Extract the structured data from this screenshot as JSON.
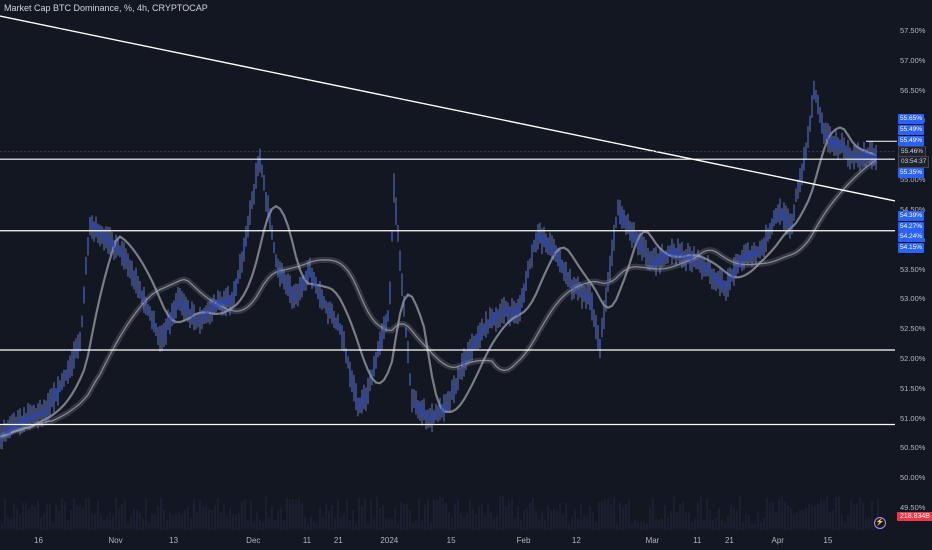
{
  "legend": {
    "text": "Market Cap BTC Dominance, %, 4h, CRYPTOCAP"
  },
  "colors": {
    "bg": "#131722",
    "price": "#3b5bd6",
    "price_light": "#7d8fdd",
    "level": "#ffffff",
    "ma_fast": "#a6a8b0",
    "ma_slow": "#5d606b",
    "tag_blue": "#2962ff",
    "volume_badge": "#f23645"
  },
  "icons": {
    "alert": "lightning-bolt-icon"
  },
  "axis_tags": {
    "t1": "55.65%",
    "t2": "55.49%",
    "t3": "55.49%",
    "current": "55.46%",
    "countdown": "03:54:37",
    "t4": "55.35%",
    "t5": "54.39%",
    "t6": "54.27%",
    "t7": "54.24%",
    "t8": "54.15%"
  },
  "volume_label": "218.834B",
  "chart_data": {
    "type": "line",
    "title": "Market Cap BTC Dominance, %, 4h, CRYPTOCAP",
    "xlabel": "",
    "ylabel": "",
    "ylim": [
      49.4,
      57.8
    ],
    "y_ticks": [
      "57.50%",
      "57.00%",
      "56.50%",
      "56.00%",
      "55.50%",
      "55.00%",
      "54.50%",
      "54.00%",
      "53.50%",
      "53.00%",
      "52.50%",
      "52.00%",
      "51.50%",
      "51.00%",
      "50.50%",
      "50.00%",
      "49.50%"
    ],
    "y_tick_values": [
      57.5,
      57.0,
      56.5,
      56.0,
      55.5,
      55.0,
      54.5,
      54.0,
      53.5,
      53.0,
      52.5,
      52.0,
      51.5,
      51.0,
      50.5,
      50.0,
      49.5
    ],
    "x_ticks": [
      "16",
      "Nov",
      "13",
      "Dec",
      "11",
      "21",
      "2024",
      "15",
      "Feb",
      "12",
      "Mar",
      "11",
      "21",
      "Apr",
      "15"
    ],
    "x_tick_values": [
      0.043,
      0.129,
      0.194,
      0.283,
      0.343,
      0.378,
      0.435,
      0.504,
      0.585,
      0.644,
      0.729,
      0.779,
      0.815,
      0.869,
      0.925
    ],
    "grid": false,
    "legend": "top-left",
    "series": [
      {
        "x": [
          0,
          0.03,
          0.05,
          0.07,
          0.09,
          0.1,
          0.12,
          0.14,
          0.16,
          0.18,
          0.2,
          0.22,
          0.24,
          0.26,
          0.275,
          0.29,
          0.31,
          0.33,
          0.345,
          0.36,
          0.38,
          0.4,
          0.41,
          0.42,
          0.435,
          0.44,
          0.46,
          0.48,
          0.5,
          0.52,
          0.54,
          0.56,
          0.58,
          0.6,
          0.62,
          0.64,
          0.66,
          0.67,
          0.69,
          0.71,
          0.73,
          0.75,
          0.77,
          0.79,
          0.81,
          0.83,
          0.85,
          0.87,
          0.885,
          0.89,
          0.9,
          0.91,
          0.92,
          0.93,
          0.94,
          0.95
        ],
        "values": [
          50.7,
          51.0,
          51.1,
          51.6,
          52.3,
          54.3,
          54.0,
          53.7,
          53.0,
          52.3,
          53.0,
          52.6,
          52.9,
          53.0,
          54.0,
          55.4,
          53.5,
          53.0,
          53.5,
          53.0,
          52.5,
          51.2,
          51.4,
          52.0,
          52.8,
          54.9,
          51.3,
          51.0,
          51.2,
          52.0,
          52.5,
          52.8,
          52.8,
          54.1,
          53.8,
          53.2,
          53.0,
          52.2,
          54.5,
          54.0,
          53.6,
          53.8,
          53.7,
          53.5,
          53.2,
          53.7,
          53.8,
          54.5,
          54.2,
          54.8,
          55.4,
          56.5,
          55.8,
          55.6,
          55.6,
          55.4
        ]
      }
    ],
    "horizontal_levels": [
      55.35,
      54.15,
      52.15,
      50.9
    ]
  }
}
